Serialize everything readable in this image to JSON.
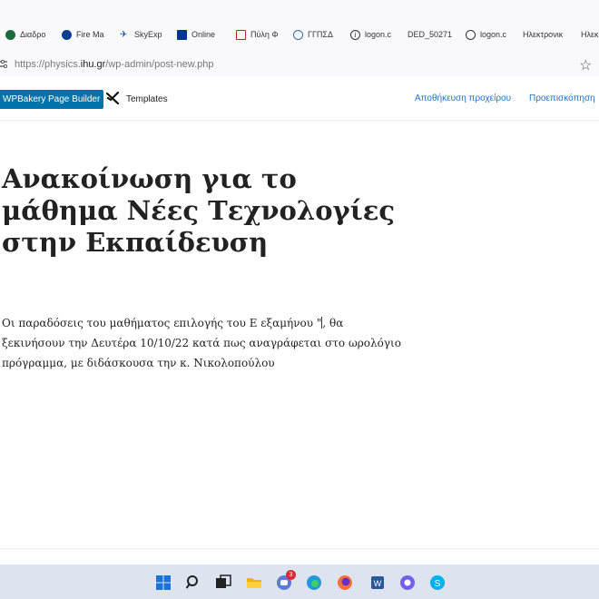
{
  "bookmarks": [
    {
      "label": "Διαδρο",
      "icon": "c-circle-icon",
      "color": "#1b6b3a"
    },
    {
      "label": "Fire Ma",
      "icon": "nasa-icon",
      "color": "#0b3d91"
    },
    {
      "label": "SkyExp",
      "icon": "plane-icon",
      "color": "#1a4aa0"
    },
    {
      "label": "Online",
      "icon": "eu-flag-icon",
      "color": "#003399"
    },
    {
      "label": "Πύλη Φ",
      "icon": "document-icon",
      "color": "#b22"
    },
    {
      "label": "ΓΓΠΣΔ",
      "icon": "emblem-icon",
      "color": "#3a6ea5"
    },
    {
      "label": "logon.c",
      "icon": "info-icon",
      "color": "#333"
    },
    {
      "label": "DED_50271",
      "icon": "",
      "color": "#333"
    },
    {
      "label": "logon.c",
      "icon": "globe-icon",
      "color": "#333"
    },
    {
      "label": "Ηλεκτρονικ",
      "icon": "",
      "color": "#333"
    },
    {
      "label": "Ηλεκ",
      "icon": "",
      "color": "#333"
    }
  ],
  "address": {
    "prefix": "https://physics.",
    "host": "ihu.gr",
    "path": "/wp-admin/post-new.php"
  },
  "toolbar": {
    "page_builder_label": "WPBakery Page Builder",
    "templates_label": "Templates",
    "save_draft_label": "Αποθήκευση προχείρου",
    "preview_label": "Προεπισκόπηση"
  },
  "post": {
    "title": "Ανακοίνωση για το μάθημα Νέες Τεχνολογίες στην Εκπαίδευση",
    "body_before_caret": "Οι παραδόσεις του μαθήματος επιλογής του Ε εξαμήνου \"",
    "body_after_caret": ", θα ξεκινήσουν την Δευτέρα 10/10/22 κατά πως αναγράφεται στο ωρολόγιο πρόγραμμα, με διδάσκουσα την κ. Νικολοπούλου"
  },
  "taskbar": {
    "icons": [
      "windows-start-icon",
      "search-icon",
      "task-view-icon",
      "file-explorer-icon",
      "chat-icon",
      "edge-icon",
      "firefox-icon",
      "word-icon",
      "viber-icon",
      "skype-icon"
    ],
    "chat_badge": "3"
  }
}
